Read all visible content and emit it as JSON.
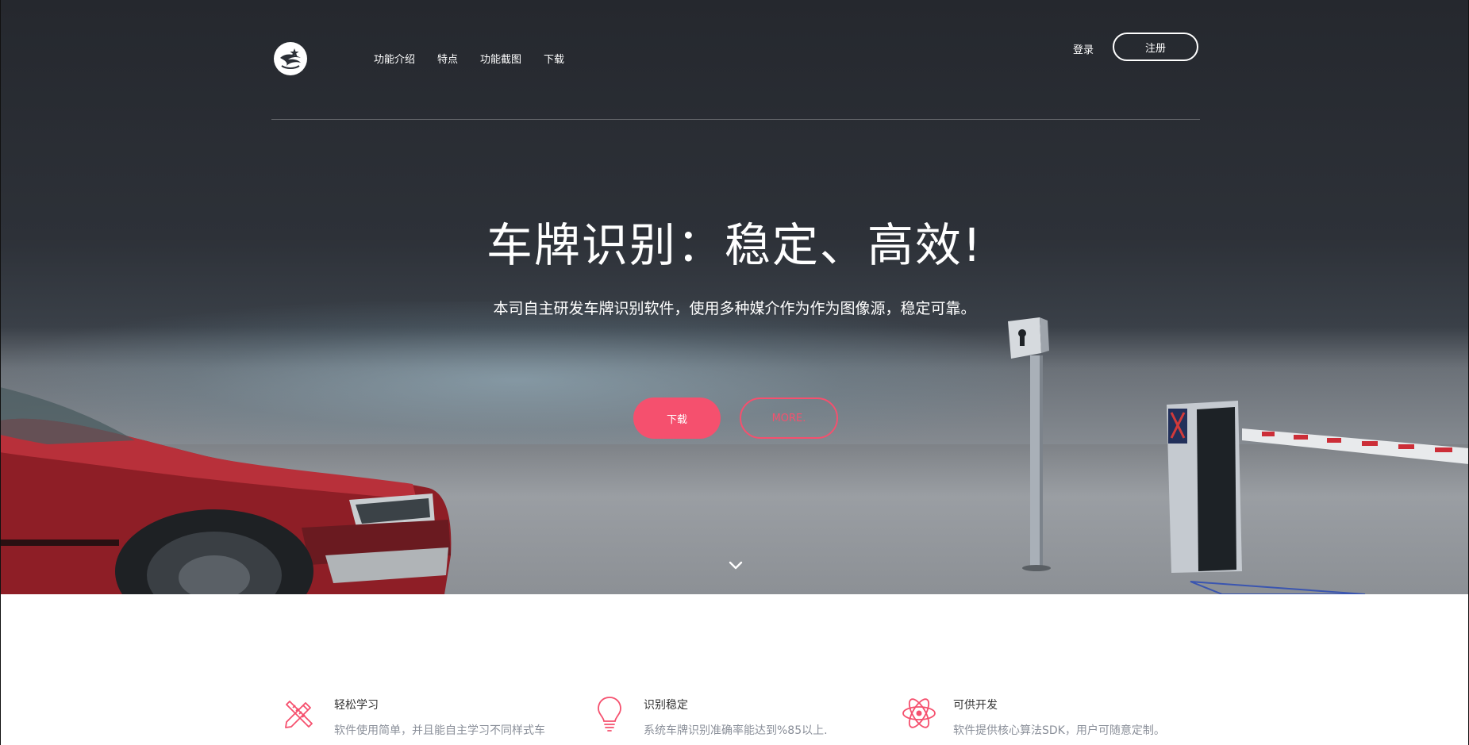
{
  "header": {
    "logo_icon": "eagle-star-logo",
    "nav": [
      "功能介绍",
      "特点",
      "功能截图",
      "下载"
    ],
    "login": "登录",
    "register": "注册"
  },
  "hero": {
    "title": "车牌识别：稳定、高效!",
    "subtitle": "本司自主研发车牌识别软件，使用多种媒介作为作为图像源，稳定可靠。",
    "primary_button": "下载",
    "secondary_button": "MORE.",
    "scroll_icon": "chevron-down-icon"
  },
  "features": [
    {
      "icon": "pencil-ruler-icon",
      "title": "轻松学习",
      "desc": "软件使用简单，并且能自主学习不同样式车"
    },
    {
      "icon": "lightbulb-icon",
      "title": "识别稳定",
      "desc": "系统车牌识别准确率能达到%85以上."
    },
    {
      "icon": "atom-icon",
      "title": "可供开发",
      "desc": "软件提供核心算法SDK，用户可随意定制。"
    }
  ],
  "colors": {
    "accent": "#f5506e",
    "hero_dark": "#25282e",
    "text_muted": "#8a8f99"
  }
}
